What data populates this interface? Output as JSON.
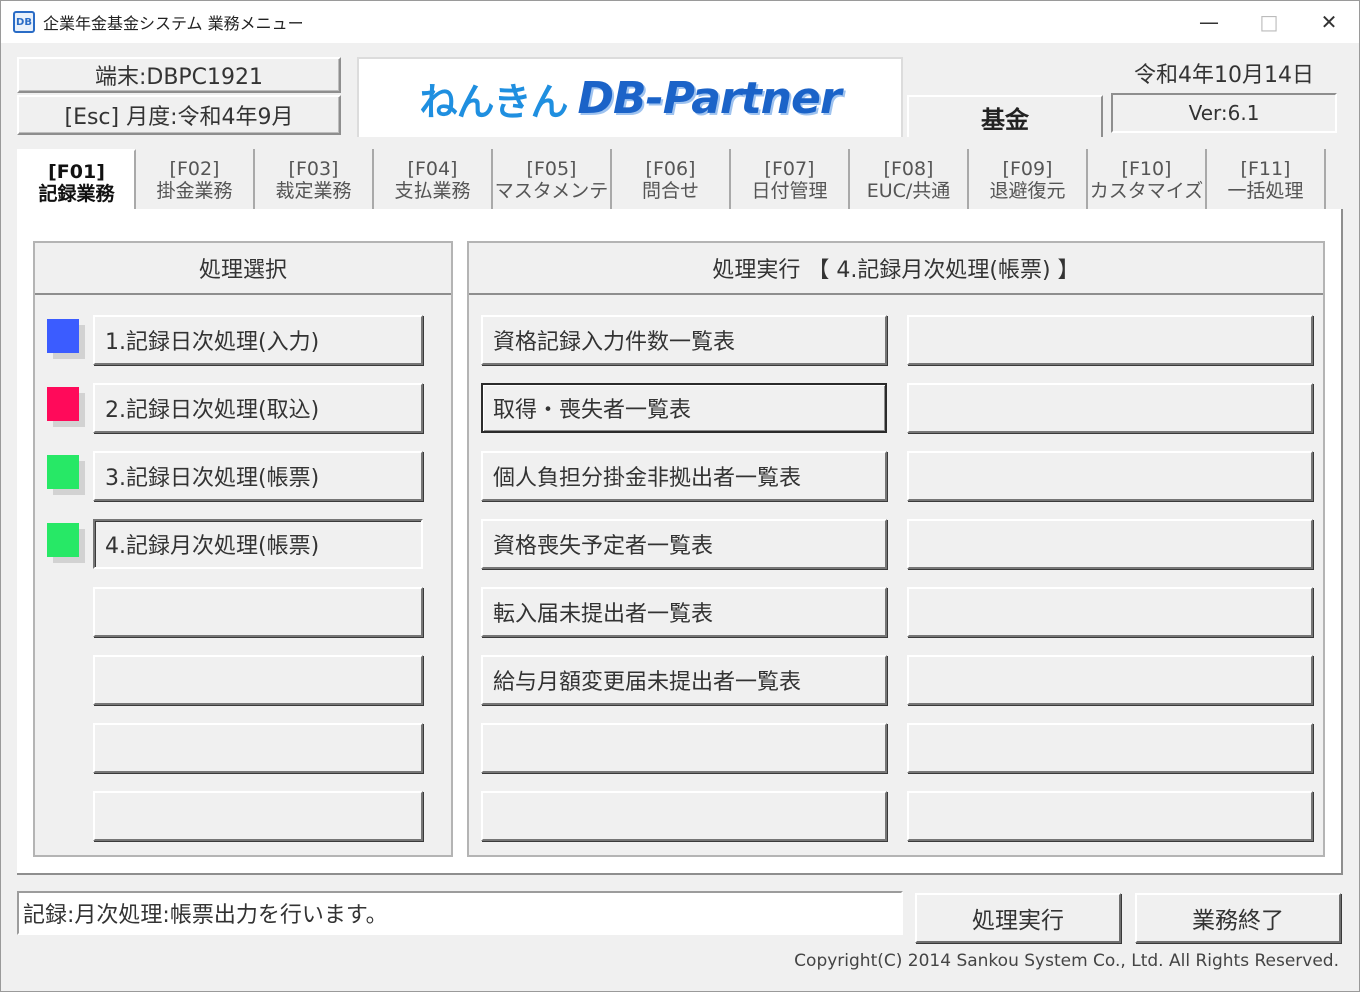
{
  "window": {
    "title": "企業年金基金システム 業務メニュー",
    "icon": "db-app-icon",
    "minimize_glyph": "—",
    "maximize_glyph": "□",
    "close_glyph": "✕"
  },
  "header": {
    "terminal": "端末:DBPC1921",
    "month": "[Esc] 月度:令和4年9月",
    "logo_kana": "ねんきん",
    "logo_en": "DB-Partner",
    "kikin": "基金",
    "date": "令和4年10月14日",
    "version": "Ver:6.1"
  },
  "tabs": [
    {
      "key": "[F01]",
      "name": "記録業務",
      "active": true
    },
    {
      "key": "[F02]",
      "name": "掛金業務",
      "active": false
    },
    {
      "key": "[F03]",
      "name": "裁定業務",
      "active": false
    },
    {
      "key": "[F04]",
      "name": "支払業務",
      "active": false
    },
    {
      "key": "[F05]",
      "name": "マスタメンテ",
      "active": false
    },
    {
      "key": "[F06]",
      "name": "問合せ",
      "active": false
    },
    {
      "key": "[F07]",
      "name": "日付管理",
      "active": false
    },
    {
      "key": "[F08]",
      "name": "EUC/共通",
      "active": false
    },
    {
      "key": "[F09]",
      "name": "退避復元",
      "active": false
    },
    {
      "key": "[F10]",
      "name": "カスタマイズ",
      "active": false
    },
    {
      "key": "[F11]",
      "name": "一括処理",
      "active": false
    }
  ],
  "select_panel": {
    "header": "処理選択",
    "items": [
      {
        "label": "1.記録日次処理(入力)",
        "color": "#3b5cff"
      },
      {
        "label": "2.記録日次処理(取込)",
        "color": "#ff0a5a"
      },
      {
        "label": "3.記録日次処理(帳票)",
        "color": "#27e866"
      },
      {
        "label": "4.記録月次処理(帳票)",
        "color": "#27e866",
        "selected": true
      },
      {
        "label": ""
      },
      {
        "label": ""
      },
      {
        "label": ""
      },
      {
        "label": ""
      }
    ]
  },
  "exec_panel": {
    "header": "処理実行 【 4.記録月次処理(帳票) 】",
    "left_items": [
      "資格記録入力件数一覧表",
      "取得・喪失者一覧表",
      "個人負担分掛金非拠出者一覧表",
      "資格喪失予定者一覧表",
      "転入届未提出者一覧表",
      "給与月額変更届未提出者一覧表",
      "",
      ""
    ],
    "right_items": [
      "",
      "",
      "",
      "",
      "",
      "",
      "",
      ""
    ],
    "focused_index": 1
  },
  "footer": {
    "status": "記録:月次処理:帳票出力を行います。",
    "exec_button": "処理実行",
    "end_button": "業務終了",
    "copyright": "Copyright(C) 2014 Sankou System Co., Ltd. All Rights Reserved."
  }
}
